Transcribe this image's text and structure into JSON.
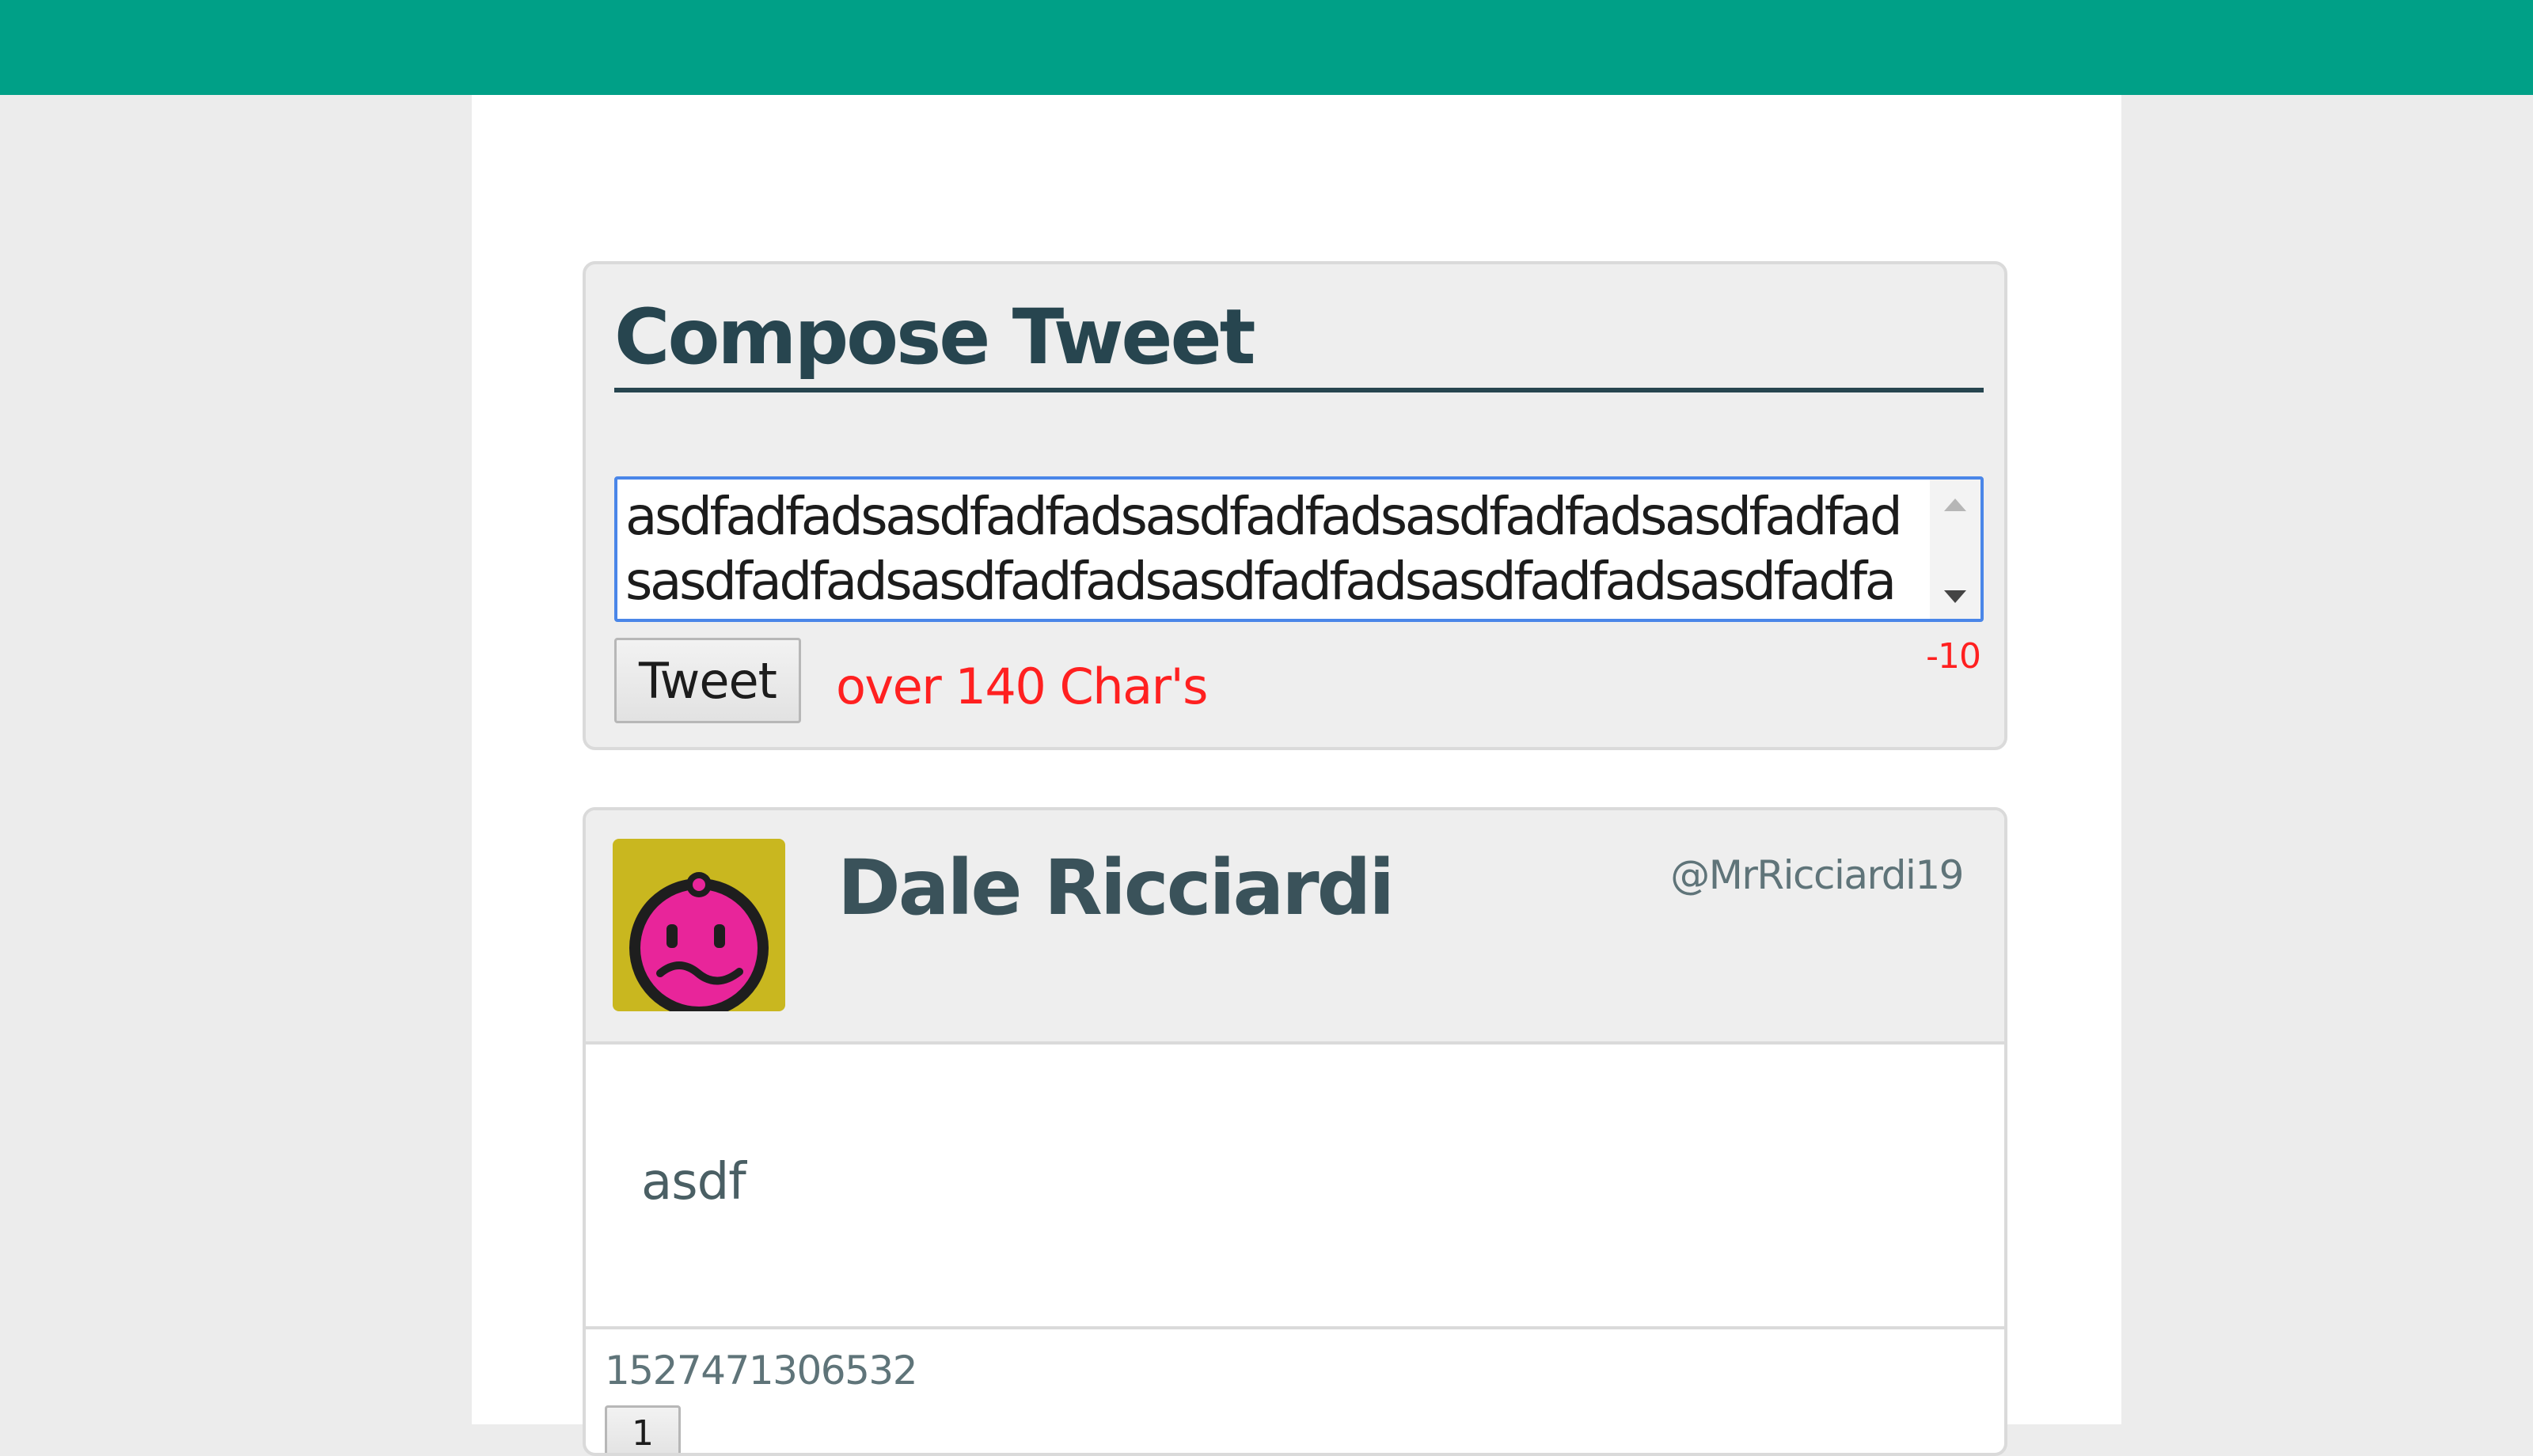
{
  "compose": {
    "title": "Compose Tweet",
    "text_value": "asdfadfadsasdfadfadsasdfadfadsasdfadfadsasdfadfadsasdfadfadsasdfadfadsasdfadfadsasdfadfadsasdfadfadsasdfadfa",
    "tweet_button_label": "Tweet",
    "error_message": "over 140 Char's",
    "char_count": "-10"
  },
  "tweet": {
    "user_name": "Dale Ricciardi",
    "user_handle": "@MrRicciardi19",
    "body": "asdf",
    "timestamp": "1527471306532",
    "like_button_label": "1"
  },
  "colors": {
    "header_bar": "#00a087",
    "title_text": "#27454f",
    "error_text": "#ff2020",
    "avatar_bg": "#c9b71f",
    "avatar_face": "#e8259a"
  },
  "icons": {
    "avatar": "sad-face-icon",
    "scroll_up": "triangle-up-icon",
    "scroll_down": "triangle-down-icon"
  }
}
